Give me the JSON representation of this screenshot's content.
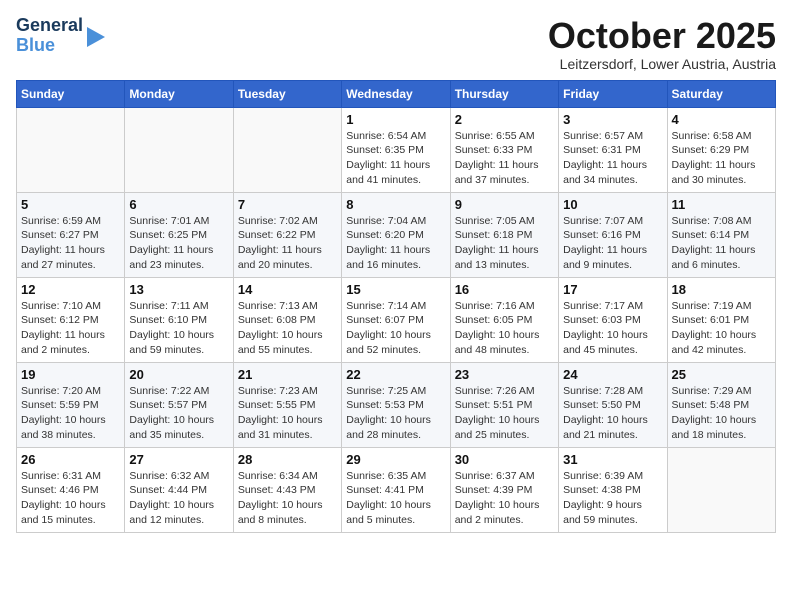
{
  "logo": {
    "line1": "General",
    "line2": "Blue"
  },
  "header": {
    "month": "October 2025",
    "location": "Leitzersdorf, Lower Austria, Austria"
  },
  "weekdays": [
    "Sunday",
    "Monday",
    "Tuesday",
    "Wednesday",
    "Thursday",
    "Friday",
    "Saturday"
  ],
  "weeks": [
    [
      {
        "day": "",
        "info": ""
      },
      {
        "day": "",
        "info": ""
      },
      {
        "day": "",
        "info": ""
      },
      {
        "day": "1",
        "info": "Sunrise: 6:54 AM\nSunset: 6:35 PM\nDaylight: 11 hours\nand 41 minutes."
      },
      {
        "day": "2",
        "info": "Sunrise: 6:55 AM\nSunset: 6:33 PM\nDaylight: 11 hours\nand 37 minutes."
      },
      {
        "day": "3",
        "info": "Sunrise: 6:57 AM\nSunset: 6:31 PM\nDaylight: 11 hours\nand 34 minutes."
      },
      {
        "day": "4",
        "info": "Sunrise: 6:58 AM\nSunset: 6:29 PM\nDaylight: 11 hours\nand 30 minutes."
      }
    ],
    [
      {
        "day": "5",
        "info": "Sunrise: 6:59 AM\nSunset: 6:27 PM\nDaylight: 11 hours\nand 27 minutes."
      },
      {
        "day": "6",
        "info": "Sunrise: 7:01 AM\nSunset: 6:25 PM\nDaylight: 11 hours\nand 23 minutes."
      },
      {
        "day": "7",
        "info": "Sunrise: 7:02 AM\nSunset: 6:22 PM\nDaylight: 11 hours\nand 20 minutes."
      },
      {
        "day": "8",
        "info": "Sunrise: 7:04 AM\nSunset: 6:20 PM\nDaylight: 11 hours\nand 16 minutes."
      },
      {
        "day": "9",
        "info": "Sunrise: 7:05 AM\nSunset: 6:18 PM\nDaylight: 11 hours\nand 13 minutes."
      },
      {
        "day": "10",
        "info": "Sunrise: 7:07 AM\nSunset: 6:16 PM\nDaylight: 11 hours\nand 9 minutes."
      },
      {
        "day": "11",
        "info": "Sunrise: 7:08 AM\nSunset: 6:14 PM\nDaylight: 11 hours\nand 6 minutes."
      }
    ],
    [
      {
        "day": "12",
        "info": "Sunrise: 7:10 AM\nSunset: 6:12 PM\nDaylight: 11 hours\nand 2 minutes."
      },
      {
        "day": "13",
        "info": "Sunrise: 7:11 AM\nSunset: 6:10 PM\nDaylight: 10 hours\nand 59 minutes."
      },
      {
        "day": "14",
        "info": "Sunrise: 7:13 AM\nSunset: 6:08 PM\nDaylight: 10 hours\nand 55 minutes."
      },
      {
        "day": "15",
        "info": "Sunrise: 7:14 AM\nSunset: 6:07 PM\nDaylight: 10 hours\nand 52 minutes."
      },
      {
        "day": "16",
        "info": "Sunrise: 7:16 AM\nSunset: 6:05 PM\nDaylight: 10 hours\nand 48 minutes."
      },
      {
        "day": "17",
        "info": "Sunrise: 7:17 AM\nSunset: 6:03 PM\nDaylight: 10 hours\nand 45 minutes."
      },
      {
        "day": "18",
        "info": "Sunrise: 7:19 AM\nSunset: 6:01 PM\nDaylight: 10 hours\nand 42 minutes."
      }
    ],
    [
      {
        "day": "19",
        "info": "Sunrise: 7:20 AM\nSunset: 5:59 PM\nDaylight: 10 hours\nand 38 minutes."
      },
      {
        "day": "20",
        "info": "Sunrise: 7:22 AM\nSunset: 5:57 PM\nDaylight: 10 hours\nand 35 minutes."
      },
      {
        "day": "21",
        "info": "Sunrise: 7:23 AM\nSunset: 5:55 PM\nDaylight: 10 hours\nand 31 minutes."
      },
      {
        "day": "22",
        "info": "Sunrise: 7:25 AM\nSunset: 5:53 PM\nDaylight: 10 hours\nand 28 minutes."
      },
      {
        "day": "23",
        "info": "Sunrise: 7:26 AM\nSunset: 5:51 PM\nDaylight: 10 hours\nand 25 minutes."
      },
      {
        "day": "24",
        "info": "Sunrise: 7:28 AM\nSunset: 5:50 PM\nDaylight: 10 hours\nand 21 minutes."
      },
      {
        "day": "25",
        "info": "Sunrise: 7:29 AM\nSunset: 5:48 PM\nDaylight: 10 hours\nand 18 minutes."
      }
    ],
    [
      {
        "day": "26",
        "info": "Sunrise: 6:31 AM\nSunset: 4:46 PM\nDaylight: 10 hours\nand 15 minutes."
      },
      {
        "day": "27",
        "info": "Sunrise: 6:32 AM\nSunset: 4:44 PM\nDaylight: 10 hours\nand 12 minutes."
      },
      {
        "day": "28",
        "info": "Sunrise: 6:34 AM\nSunset: 4:43 PM\nDaylight: 10 hours\nand 8 minutes."
      },
      {
        "day": "29",
        "info": "Sunrise: 6:35 AM\nSunset: 4:41 PM\nDaylight: 10 hours\nand 5 minutes."
      },
      {
        "day": "30",
        "info": "Sunrise: 6:37 AM\nSunset: 4:39 PM\nDaylight: 10 hours\nand 2 minutes."
      },
      {
        "day": "31",
        "info": "Sunrise: 6:39 AM\nSunset: 4:38 PM\nDaylight: 9 hours\nand 59 minutes."
      },
      {
        "day": "",
        "info": ""
      }
    ]
  ]
}
